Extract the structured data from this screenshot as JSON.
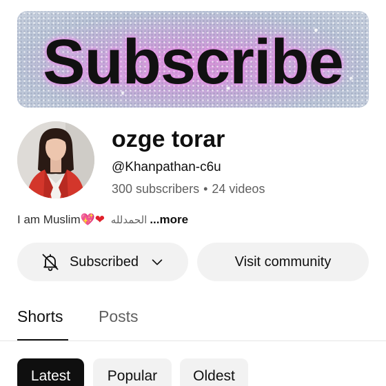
{
  "banner": {
    "text": "Subscribe"
  },
  "channel": {
    "name": "ozge torar",
    "handle": "@Khanpathan-c6u",
    "subscribers": "300 subscribers",
    "separator": "•",
    "videos": "24 videos"
  },
  "description": {
    "text": "I am Muslim",
    "emoji_pink_heart": "💖",
    "emoji_red_heart": "❤",
    "arabic": "الحمدلله",
    "more": "...more"
  },
  "actions": {
    "subscribed_label": "Subscribed",
    "visit_community_label": "Visit community"
  },
  "tabs": [
    {
      "label": "Shorts",
      "selected": true
    },
    {
      "label": "Posts",
      "selected": false
    }
  ],
  "filters": [
    {
      "label": "Latest",
      "selected": true
    },
    {
      "label": "Popular",
      "selected": false
    },
    {
      "label": "Oldest",
      "selected": false
    }
  ],
  "colors": {
    "text_primary": "#0f0f0f",
    "text_secondary": "#606060",
    "chip_bg": "#f2f2f2",
    "chip_selected_bg": "#0f0f0f"
  },
  "icons": {
    "bell": "notifications-off-icon",
    "chevron": "chevron-down-icon"
  }
}
